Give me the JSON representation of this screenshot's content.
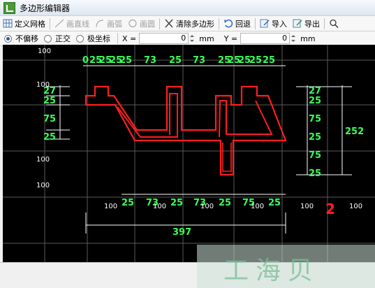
{
  "window": {
    "title": "多边形编辑器"
  },
  "toolbar": {
    "define_grid": "定义网格",
    "draw_line": "画直线",
    "draw_arc": "画弧",
    "draw_circle": "画圆",
    "clear_polygon": "清除多边形",
    "undo": "回退",
    "import": "导入",
    "export": "导出"
  },
  "options": {
    "no_offset": "不偏移",
    "ortho": "正交",
    "polar": "极坐标",
    "x_label": "X =",
    "x_value": "0",
    "x_unit": "mm",
    "y_label": "Y =",
    "y_value": "0",
    "y_unit": "mm"
  },
  "canvas": {
    "top_dims": [
      "0",
      "25",
      "25",
      "25",
      "25",
      "73",
      "25",
      "73",
      "25",
      "25",
      "25",
      "25",
      "25"
    ],
    "left_dims": [
      "27",
      "25",
      "75",
      "25"
    ],
    "left_grid": [
      "100",
      "100",
      "100"
    ],
    "top_grid": [
      "100"
    ],
    "right_dims": [
      "27",
      "25",
      "75",
      "25",
      "75",
      "25"
    ],
    "right_total": "252",
    "bottom_dims": [
      "25",
      "73",
      "25",
      "73",
      "25",
      "75",
      "25"
    ],
    "bottom_grid": [
      "100",
      "100",
      "100",
      "100",
      "100",
      "100",
      "100"
    ],
    "bottom_total": "397",
    "label_2": "2"
  },
  "watermark": "工海贝"
}
